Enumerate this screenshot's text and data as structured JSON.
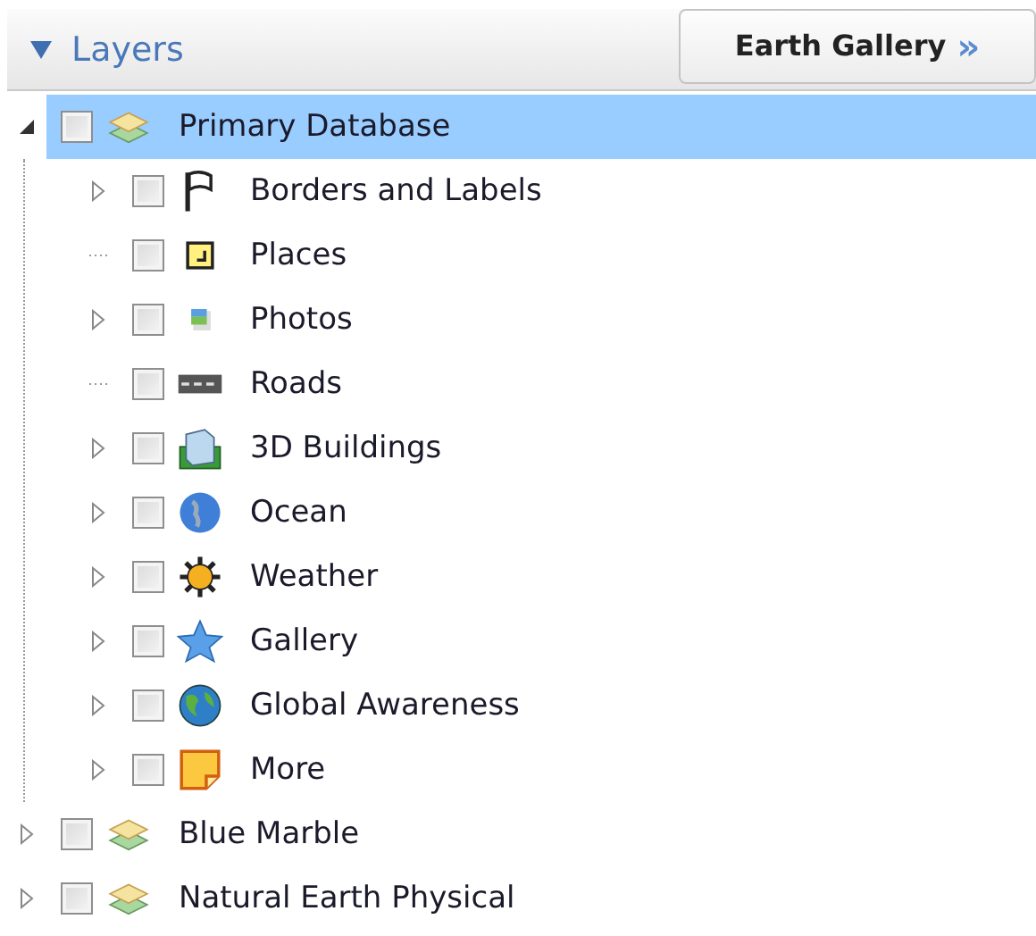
{
  "panel": {
    "title": "Layers",
    "expanded": true
  },
  "gallery_button": {
    "label": "Earth Gallery",
    "arrows": "»"
  },
  "tree": [
    {
      "label": "Primary Database",
      "kind": "layers",
      "checked": false,
      "selected": true,
      "expandable": true,
      "expanded": true,
      "children": [
        {
          "label": "Borders and Labels",
          "kind": "flag",
          "checked": false,
          "selected": false,
          "expandable": true,
          "expanded": false
        },
        {
          "label": "Places",
          "kind": "place",
          "checked": false,
          "selected": false,
          "expandable": false,
          "expanded": false
        },
        {
          "label": "Photos",
          "kind": "photo",
          "checked": false,
          "selected": false,
          "expandable": true,
          "expanded": false
        },
        {
          "label": "Roads",
          "kind": "road",
          "checked": false,
          "selected": false,
          "expandable": false,
          "expanded": false
        },
        {
          "label": "3D Buildings",
          "kind": "building",
          "checked": false,
          "selected": false,
          "expandable": true,
          "expanded": false
        },
        {
          "label": "Ocean",
          "kind": "ocean",
          "checked": false,
          "selected": false,
          "expandable": true,
          "expanded": false
        },
        {
          "label": "Weather",
          "kind": "sun",
          "checked": false,
          "selected": false,
          "expandable": true,
          "expanded": false
        },
        {
          "label": "Gallery",
          "kind": "star",
          "checked": false,
          "selected": false,
          "expandable": true,
          "expanded": false
        },
        {
          "label": "Global Awareness",
          "kind": "globe",
          "checked": false,
          "selected": false,
          "expandable": true,
          "expanded": false
        },
        {
          "label": "More",
          "kind": "note",
          "checked": false,
          "selected": false,
          "expandable": true,
          "expanded": false
        }
      ]
    },
    {
      "label": "Blue Marble",
      "kind": "layers",
      "checked": false,
      "selected": false,
      "expandable": true,
      "expanded": false
    },
    {
      "label": "Natural Earth Physical",
      "kind": "layers",
      "checked": false,
      "selected": false,
      "expandable": true,
      "expanded": false
    }
  ]
}
